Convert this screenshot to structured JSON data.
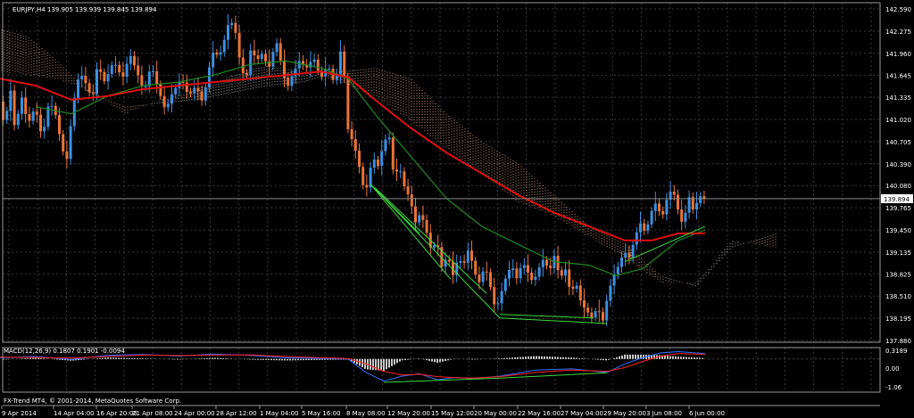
{
  "header": {
    "symbol_info": "EURJPY,H4  139.905 139.939 139.845 139.894"
  },
  "macd": {
    "label": "MACD(12,26,9) 0.1807 0.1901 -0.0094",
    "scale_labels": [
      "0.3189",
      "0.00",
      "-1.06"
    ]
  },
  "footer": {
    "copyright": "FX-Trend MT4, © 2001-2014, MetaQuotes Software Corp."
  },
  "colors": {
    "background": "#000000",
    "grid": "#3a3a3a",
    "frame": "#9a9a9a",
    "text": "#ffffff",
    "bull_candle": "#3d8fe0",
    "bear_candle": "#e8743a",
    "ma_slow": "#e01010",
    "ma_fast": "#1f8a1f",
    "cloud_a": "#f0b08a",
    "cloud_b": "#d8d8d8",
    "trend_lines": "#3cdc3c",
    "macd_hist": "#c8c8c8",
    "macd_main": "#3070ff",
    "macd_signal": "#ff2020"
  },
  "chart_data": {
    "type": "candlestick",
    "symbol": "EURJPY",
    "timeframe": "H4",
    "current_price": 139.894,
    "ohlc_header": {
      "open": 139.905,
      "high": 139.939,
      "low": 139.845,
      "close": 139.894
    },
    "y_ticks": [
      142.59,
      142.275,
      141.96,
      141.645,
      141.335,
      141.02,
      140.705,
      140.39,
      140.08,
      139.765,
      139.45,
      139.135,
      138.825,
      138.51,
      138.195,
      137.88
    ],
    "y_tick_labels": [
      "142.590",
      "142.275",
      "141.960",
      "141.645",
      "141.335",
      "141.020",
      "140.705",
      "140.390",
      "140.080",
      "139.765",
      "139.450",
      "139.135",
      "138.825",
      "138.510",
      "138.195",
      "137.880"
    ],
    "x_tick_labels": [
      "9 Apr 2014",
      "14 Apr 04:00",
      "16 Apr 20:00",
      "21 Apr 08:00",
      "24 Apr 00:00",
      "28 Apr 12:00",
      "1 May 04:00",
      "5 May 16:00",
      "8 May 08:00",
      "12 May 20:00",
      "15 May 12:00",
      "20 May 00:00",
      "22 May 16:00",
      "27 May 04:00",
      "29 May 20:00",
      "3 Jun 08:00",
      "6 Jun 00:00"
    ],
    "price_path": [
      [
        0,
        141.4
      ],
      [
        8,
        140.9
      ],
      [
        14,
        141.5
      ],
      [
        20,
        140.8
      ],
      [
        26,
        141.4
      ],
      [
        34,
        140.95
      ],
      [
        42,
        141.2
      ],
      [
        50,
        140.75
      ],
      [
        58,
        141.3
      ],
      [
        66,
        141.05
      ],
      [
        72,
        140.6
      ],
      [
        78,
        140.45
      ],
      [
        84,
        141.2
      ],
      [
        92,
        141.7
      ],
      [
        100,
        141.5
      ],
      [
        106,
        141.3
      ],
      [
        112,
        141.8
      ],
      [
        120,
        141.55
      ],
      [
        130,
        141.85
      ],
      [
        140,
        141.6
      ],
      [
        148,
        141.95
      ],
      [
        156,
        141.7
      ],
      [
        164,
        141.4
      ],
      [
        172,
        141.8
      ],
      [
        180,
        141.45
      ],
      [
        188,
        141.15
      ],
      [
        196,
        141.4
      ],
      [
        206,
        141.6
      ],
      [
        214,
        141.35
      ],
      [
        222,
        141.5
      ],
      [
        230,
        141.25
      ],
      [
        236,
        141.7
      ],
      [
        242,
        142.0
      ],
      [
        248,
        141.9
      ],
      [
        254,
        142.15
      ],
      [
        260,
        142.45
      ],
      [
        266,
        142.3
      ],
      [
        272,
        141.8
      ],
      [
        278,
        141.55
      ],
      [
        284,
        142.05
      ],
      [
        290,
        141.85
      ],
      [
        296,
        141.95
      ],
      [
        304,
        141.75
      ],
      [
        312,
        142.15
      ],
      [
        318,
        141.8
      ],
      [
        324,
        141.45
      ],
      [
        330,
        141.65
      ],
      [
        338,
        141.85
      ],
      [
        346,
        141.75
      ],
      [
        354,
        141.9
      ],
      [
        362,
        141.6
      ],
      [
        370,
        141.8
      ],
      [
        378,
        141.5
      ],
      [
        384,
        142.0
      ],
      [
        388,
        141.7
      ],
      [
        392,
        140.9
      ],
      [
        398,
        140.7
      ],
      [
        404,
        140.45
      ],
      [
        408,
        140.1
      ],
      [
        414,
        140.05
      ],
      [
        420,
        140.5
      ],
      [
        426,
        140.35
      ],
      [
        432,
        140.65
      ],
      [
        438,
        140.85
      ],
      [
        444,
        140.2
      ],
      [
        450,
        140.35
      ],
      [
        456,
        140.05
      ],
      [
        462,
        139.9
      ],
      [
        468,
        139.55
      ],
      [
        474,
        139.7
      ],
      [
        480,
        139.45
      ],
      [
        486,
        139.15
      ],
      [
        492,
        139.3
      ],
      [
        498,
        138.9
      ],
      [
        504,
        139.1
      ],
      [
        510,
        138.8
      ],
      [
        516,
        139.05
      ],
      [
        522,
        138.95
      ],
      [
        528,
        139.2
      ],
      [
        534,
        138.85
      ],
      [
        540,
        138.7
      ],
      [
        546,
        138.95
      ],
      [
        552,
        138.65
      ],
      [
        558,
        138.3
      ],
      [
        564,
        138.55
      ],
      [
        570,
        138.8
      ],
      [
        576,
        138.95
      ],
      [
        582,
        138.75
      ],
      [
        588,
        139.0
      ],
      [
        594,
        138.85
      ],
      [
        600,
        138.7
      ],
      [
        606,
        138.9
      ],
      [
        612,
        139.05
      ],
      [
        618,
        138.85
      ],
      [
        624,
        139.1
      ],
      [
        630,
        138.75
      ],
      [
        636,
        138.9
      ],
      [
        642,
        138.55
      ],
      [
        648,
        138.7
      ],
      [
        654,
        138.4
      ],
      [
        660,
        138.3
      ],
      [
        666,
        138.2
      ],
      [
        672,
        138.35
      ],
      [
        678,
        138.15
      ],
      [
        684,
        138.55
      ],
      [
        690,
        138.8
      ],
      [
        696,
        138.95
      ],
      [
        702,
        139.15
      ],
      [
        708,
        139.05
      ],
      [
        714,
        139.35
      ],
      [
        720,
        139.55
      ],
      [
        726,
        139.4
      ],
      [
        732,
        139.7
      ],
      [
        738,
        139.85
      ],
      [
        744,
        139.6
      ],
      [
        750,
        139.9
      ],
      [
        756,
        140.05
      ],
      [
        762,
        139.75
      ],
      [
        768,
        139.5
      ],
      [
        774,
        139.95
      ],
      [
        780,
        139.7
      ],
      [
        786,
        139.95
      ],
      [
        790,
        139.89
      ]
    ],
    "ma_slow": [
      [
        0,
        141.6
      ],
      [
        40,
        141.5
      ],
      [
        80,
        141.3
      ],
      [
        120,
        141.35
      ],
      [
        160,
        141.45
      ],
      [
        200,
        141.5
      ],
      [
        240,
        141.55
      ],
      [
        280,
        141.6
      ],
      [
        320,
        141.65
      ],
      [
        360,
        141.7
      ],
      [
        390,
        141.62
      ],
      [
        420,
        141.3
      ],
      [
        460,
        140.9
      ],
      [
        500,
        140.55
      ],
      [
        540,
        140.25
      ],
      [
        580,
        139.95
      ],
      [
        620,
        139.7
      ],
      [
        660,
        139.5
      ],
      [
        700,
        139.3
      ],
      [
        730,
        139.3
      ],
      [
        760,
        139.4
      ],
      [
        790,
        139.4
      ]
    ],
    "ma_fast": [
      [
        40,
        141.2
      ],
      [
        80,
        141.1
      ],
      [
        120,
        141.35
      ],
      [
        160,
        141.5
      ],
      [
        200,
        141.55
      ],
      [
        240,
        141.65
      ],
      [
        280,
        141.8
      ],
      [
        320,
        141.85
      ],
      [
        360,
        141.75
      ],
      [
        390,
        141.6
      ],
      [
        420,
        141.1
      ],
      [
        460,
        140.5
      ],
      [
        500,
        139.9
      ],
      [
        540,
        139.5
      ],
      [
        580,
        139.25
      ],
      [
        620,
        139.0
      ],
      [
        660,
        138.95
      ],
      [
        690,
        138.8
      ],
      [
        720,
        138.9
      ],
      [
        760,
        139.3
      ],
      [
        790,
        139.45
      ]
    ],
    "cloud_a": [
      [
        0,
        142.3
      ],
      [
        30,
        142.2
      ],
      [
        60,
        141.9
      ],
      [
        100,
        141.4
      ],
      [
        140,
        141.2
      ],
      [
        180,
        141.25
      ],
      [
        220,
        141.3
      ],
      [
        260,
        141.4
      ],
      [
        300,
        141.5
      ],
      [
        340,
        141.55
      ],
      [
        380,
        141.7
      ],
      [
        420,
        141.75
      ],
      [
        460,
        141.6
      ],
      [
        500,
        141.1
      ],
      [
        540,
        140.7
      ],
      [
        580,
        140.4
      ],
      [
        620,
        139.95
      ],
      [
        660,
        139.5
      ],
      [
        700,
        139.25
      ],
      [
        740,
        138.8
      ],
      [
        780,
        138.65
      ],
      [
        820,
        139.2
      ],
      [
        870,
        139.4
      ]
    ],
    "cloud_b": [
      [
        0,
        141.7
      ],
      [
        30,
        141.65
      ],
      [
        60,
        141.6
      ],
      [
        100,
        141.45
      ],
      [
        140,
        141.1
      ],
      [
        180,
        141.3
      ],
      [
        220,
        141.45
      ],
      [
        260,
        141.65
      ],
      [
        300,
        141.8
      ],
      [
        340,
        141.7
      ],
      [
        380,
        141.55
      ],
      [
        420,
        141.35
      ],
      [
        460,
        141.0
      ],
      [
        500,
        140.6
      ],
      [
        540,
        140.25
      ],
      [
        580,
        139.85
      ],
      [
        620,
        139.65
      ],
      [
        660,
        139.35
      ],
      [
        700,
        139.05
      ],
      [
        740,
        138.7
      ],
      [
        780,
        138.7
      ],
      [
        820,
        139.3
      ],
      [
        870,
        139.2
      ]
    ],
    "trend_lines": [
      [
        [
          415,
          140.1
        ],
        [
          505,
          138.75
        ]
      ],
      [
        [
          415,
          140.1
        ],
        [
          560,
          138.2
        ]
      ],
      [
        [
          415,
          140.1
        ],
        [
          470,
          139.4
        ]
      ],
      [
        [
          420,
          140.05
        ],
        [
          545,
          138.55
        ]
      ],
      [
        [
          560,
          138.2
        ],
        [
          680,
          138.12
        ]
      ],
      [
        [
          560,
          138.25
        ],
        [
          665,
          138.2
        ]
      ],
      [
        [
          700,
          139.0
        ],
        [
          790,
          139.5
        ]
      ]
    ],
    "macd_scale": {
      "max": 0.3189,
      "min": -1.06
    },
    "macd_main": [
      [
        0,
        0.05
      ],
      [
        40,
        0.1
      ],
      [
        80,
        -0.02
      ],
      [
        120,
        0.15
      ],
      [
        160,
        0.18
      ],
      [
        200,
        0.12
      ],
      [
        240,
        0.2
      ],
      [
        280,
        0.15
      ],
      [
        320,
        0.05
      ],
      [
        360,
        0.02
      ],
      [
        390,
        0.0
      ],
      [
        410,
        -0.55
      ],
      [
        430,
        -0.9
      ],
      [
        450,
        -0.7
      ],
      [
        470,
        -0.6
      ],
      [
        490,
        -0.85
      ],
      [
        510,
        -0.75
      ],
      [
        530,
        -0.8
      ],
      [
        560,
        -0.7
      ],
      [
        600,
        -0.45
      ],
      [
        640,
        -0.4
      ],
      [
        680,
        -0.55
      ],
      [
        700,
        -0.2
      ],
      [
        720,
        0.05
      ],
      [
        740,
        0.25
      ],
      [
        760,
        0.3
      ],
      [
        790,
        0.22
      ]
    ],
    "macd_signal": [
      [
        0,
        0.08
      ],
      [
        40,
        0.06
      ],
      [
        80,
        0.04
      ],
      [
        120,
        0.1
      ],
      [
        160,
        0.16
      ],
      [
        200,
        0.14
      ],
      [
        240,
        0.16
      ],
      [
        280,
        0.17
      ],
      [
        320,
        0.1
      ],
      [
        360,
        0.05
      ],
      [
        390,
        0.02
      ],
      [
        410,
        -0.2
      ],
      [
        430,
        -0.5
      ],
      [
        450,
        -0.65
      ],
      [
        470,
        -0.62
      ],
      [
        490,
        -0.72
      ],
      [
        510,
        -0.76
      ],
      [
        530,
        -0.78
      ],
      [
        560,
        -0.72
      ],
      [
        600,
        -0.55
      ],
      [
        640,
        -0.45
      ],
      [
        680,
        -0.5
      ],
      [
        700,
        -0.35
      ],
      [
        720,
        -0.1
      ],
      [
        740,
        0.12
      ],
      [
        760,
        0.22
      ],
      [
        790,
        0.19
      ]
    ],
    "macd_trend_lines": [
      [
        [
          430,
          -0.95
        ],
        [
          560,
          -0.78
        ]
      ],
      [
        [
          560,
          -0.78
        ],
        [
          680,
          -0.56
        ]
      ]
    ]
  }
}
